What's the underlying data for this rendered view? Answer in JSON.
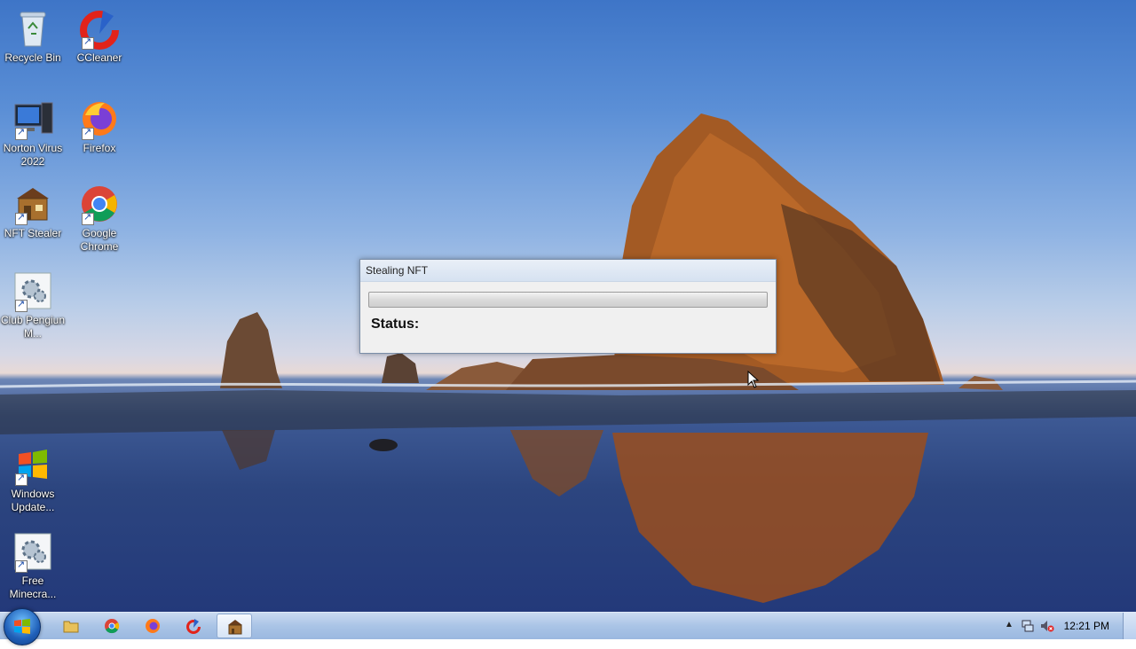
{
  "desktop_icons": [
    {
      "label": "Recycle Bin",
      "icon": "recycle-bin-icon"
    },
    {
      "label": "CCleaner",
      "icon": "ccleaner-icon"
    },
    {
      "label": "Norton Virus 2022",
      "icon": "norton-icon"
    },
    {
      "label": "Firefox",
      "icon": "firefox-icon"
    },
    {
      "label": "NFT Stealer",
      "icon": "nft-stealer-icon"
    },
    {
      "label": "Google Chrome",
      "icon": "chrome-icon"
    },
    {
      "label": "Club Pengiun M...",
      "icon": "setup-icon"
    },
    {
      "label": "Windows Update...",
      "icon": "windows-update-icon"
    },
    {
      "label": "Free Minecra...",
      "icon": "setup-icon"
    }
  ],
  "dialog": {
    "title": "Stealing NFT",
    "progress": 0,
    "status_label": "Status:"
  },
  "taskbar": {
    "start_icon": "windows-start-icon",
    "pinned": [
      "file-explorer-icon",
      "chrome-icon",
      "firefox-icon",
      "ccleaner-icon",
      "nft-stealer-icon"
    ],
    "active": "nft-stealer-icon",
    "tray_icons": [
      "show-hidden-icons-icon",
      "network-icon",
      "volume-muted-icon"
    ],
    "clock": "12:21 PM"
  }
}
